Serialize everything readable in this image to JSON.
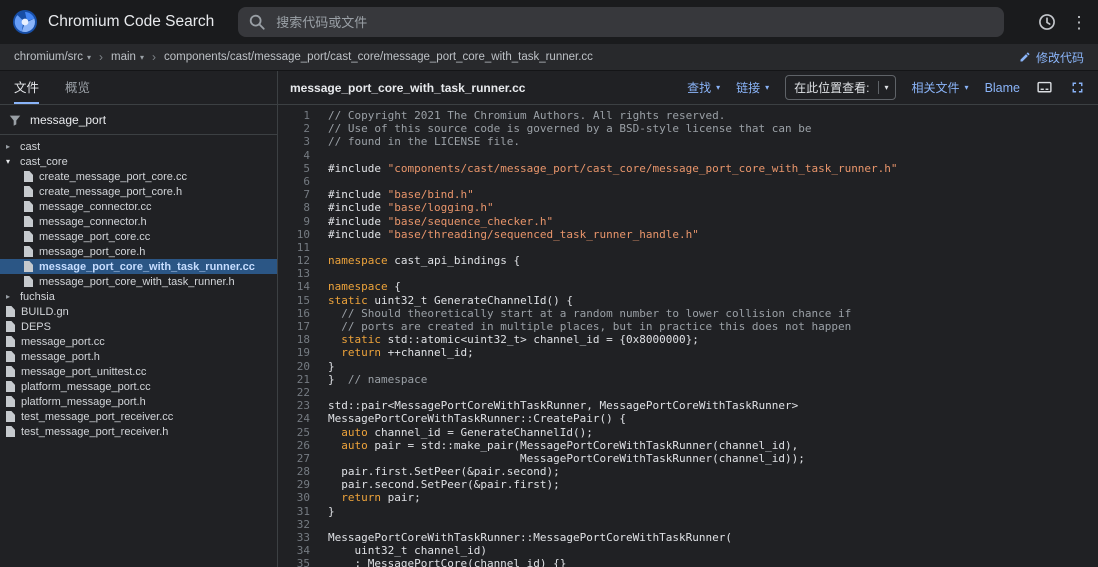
{
  "colors": {
    "accent": "#8ab4f8",
    "selection": "#2b5685",
    "keyword": "#eda33b",
    "string": "#e8956b",
    "comment": "#9aa0a6",
    "codetext": "#dfe1e5"
  },
  "icons": {
    "chevron_down": "▾",
    "chevron_right": "▸",
    "separator": "›",
    "kebab": "⋮"
  },
  "header": {
    "app_title": "Chromium Code Search",
    "search_placeholder": "搜索代码或文件"
  },
  "breadcrumb": {
    "repo": "chromium/src",
    "branch": "main",
    "path": "components/cast/message_port/cast_core/message_port_core_with_task_runner.cc",
    "edit_label": "修改代码"
  },
  "sidebar": {
    "tabs": [
      {
        "label": "文件",
        "active": true
      },
      {
        "label": "概览",
        "active": false
      }
    ],
    "filter_value": "message_port",
    "tree": [
      {
        "label": "cast",
        "kind": "folder",
        "expanded": false,
        "depth": 0
      },
      {
        "label": "cast_core",
        "kind": "folder",
        "expanded": true,
        "depth": 0
      },
      {
        "label": "create_message_port_core.cc",
        "kind": "file",
        "depth": 1
      },
      {
        "label": "create_message_port_core.h",
        "kind": "file",
        "depth": 1
      },
      {
        "label": "message_connector.cc",
        "kind": "file",
        "depth": 1
      },
      {
        "label": "message_connector.h",
        "kind": "file",
        "depth": 1
      },
      {
        "label": "message_port_core.cc",
        "kind": "file",
        "depth": 1
      },
      {
        "label": "message_port_core.h",
        "kind": "file",
        "depth": 1
      },
      {
        "label": "message_port_core_with_task_runner.cc",
        "kind": "file",
        "depth": 1,
        "selected": true
      },
      {
        "label": "message_port_core_with_task_runner.h",
        "kind": "file",
        "depth": 1
      },
      {
        "label": "fuchsia",
        "kind": "folder",
        "expanded": false,
        "depth": 0
      },
      {
        "label": "BUILD.gn",
        "kind": "file",
        "depth": 0
      },
      {
        "label": "DEPS",
        "kind": "file",
        "depth": 0
      },
      {
        "label": "message_port.cc",
        "kind": "file",
        "depth": 0
      },
      {
        "label": "message_port.h",
        "kind": "file",
        "depth": 0
      },
      {
        "label": "message_port_unittest.cc",
        "kind": "file",
        "depth": 0
      },
      {
        "label": "platform_message_port.cc",
        "kind": "file",
        "depth": 0
      },
      {
        "label": "platform_message_port.h",
        "kind": "file",
        "depth": 0
      },
      {
        "label": "test_message_port_receiver.cc",
        "kind": "file",
        "depth": 0
      },
      {
        "label": "test_message_port_receiver.h",
        "kind": "file",
        "depth": 0
      }
    ]
  },
  "main": {
    "file_title": "message_port_core_with_task_runner.cc",
    "toolbar": {
      "find_label": "查找",
      "links_label": "链接",
      "view_here_label": "在此位置查看:",
      "related_files_label": "相关文件",
      "blame_label": "Blame"
    },
    "code": {
      "lines": [
        [
          [
            "c",
            "// Copyright 2021 The Chromium Authors. All rights reserved."
          ]
        ],
        [
          [
            "c",
            "// Use of this source code is governed by a BSD-style license that can be"
          ]
        ],
        [
          [
            "c",
            "// found in the LICENSE file."
          ]
        ],
        [],
        [
          [
            "d",
            "#include "
          ],
          [
            "s",
            "\"components/cast/message_port/cast_core/message_port_core_with_task_runner.h\""
          ]
        ],
        [],
        [
          [
            "d",
            "#include "
          ],
          [
            "s",
            "\"base/bind.h\""
          ]
        ],
        [
          [
            "d",
            "#include "
          ],
          [
            "s",
            "\"base/logging.h\""
          ]
        ],
        [
          [
            "d",
            "#include "
          ],
          [
            "s",
            "\"base/sequence_checker.h\""
          ]
        ],
        [
          [
            "d",
            "#include "
          ],
          [
            "s",
            "\"base/threading/sequenced_task_runner_handle.h\""
          ]
        ],
        [],
        [
          [
            "k",
            "namespace"
          ],
          [
            "d",
            " cast_api_bindings {"
          ]
        ],
        [],
        [
          [
            "k",
            "namespace"
          ],
          [
            "d",
            " {"
          ]
        ],
        [
          [
            "k",
            "static"
          ],
          [
            "d",
            " uint32_t GenerateChannelId() {"
          ]
        ],
        [
          [
            "d",
            "  "
          ],
          [
            "c",
            "// Should theoretically start at a random number to lower collision chance if"
          ]
        ],
        [
          [
            "d",
            "  "
          ],
          [
            "c",
            "// ports are created in multiple places, but in practice this does not happen"
          ]
        ],
        [
          [
            "d",
            "  "
          ],
          [
            "k",
            "static"
          ],
          [
            "d",
            " std::atomic<uint32_t> channel_id = {0x8000000};"
          ]
        ],
        [
          [
            "d",
            "  "
          ],
          [
            "k",
            "return"
          ],
          [
            "d",
            " ++channel_id;"
          ]
        ],
        [
          [
            "d",
            "}"
          ]
        ],
        [
          [
            "d",
            "}  "
          ],
          [
            "c",
            "// namespace"
          ]
        ],
        [],
        [
          [
            "d",
            "std::pair<MessagePortCoreWithTaskRunner, MessagePortCoreWithTaskRunner>"
          ]
        ],
        [
          [
            "d",
            "MessagePortCoreWithTaskRunner::CreatePair() {"
          ]
        ],
        [
          [
            "d",
            "  "
          ],
          [
            "k",
            "auto"
          ],
          [
            "d",
            " channel_id = GenerateChannelId();"
          ]
        ],
        [
          [
            "d",
            "  "
          ],
          [
            "k",
            "auto"
          ],
          [
            "d",
            " pair = std::make_pair(MessagePortCoreWithTaskRunner(channel_id),"
          ]
        ],
        [
          [
            "d",
            "                             MessagePortCoreWithTaskRunner(channel_id));"
          ]
        ],
        [
          [
            "d",
            "  pair.first.SetPeer(&pair.second);"
          ]
        ],
        [
          [
            "d",
            "  pair.second.SetPeer(&pair.first);"
          ]
        ],
        [
          [
            "d",
            "  "
          ],
          [
            "k",
            "return"
          ],
          [
            "d",
            " pair;"
          ]
        ],
        [
          [
            "d",
            "}"
          ]
        ],
        [],
        [
          [
            "d",
            "MessagePortCoreWithTaskRunner::MessagePortCoreWithTaskRunner("
          ]
        ],
        [
          [
            "d",
            "    uint32_t channel_id)"
          ]
        ],
        [
          [
            "d",
            "    : MessagePortCore(channel_id) {}"
          ]
        ]
      ]
    }
  }
}
